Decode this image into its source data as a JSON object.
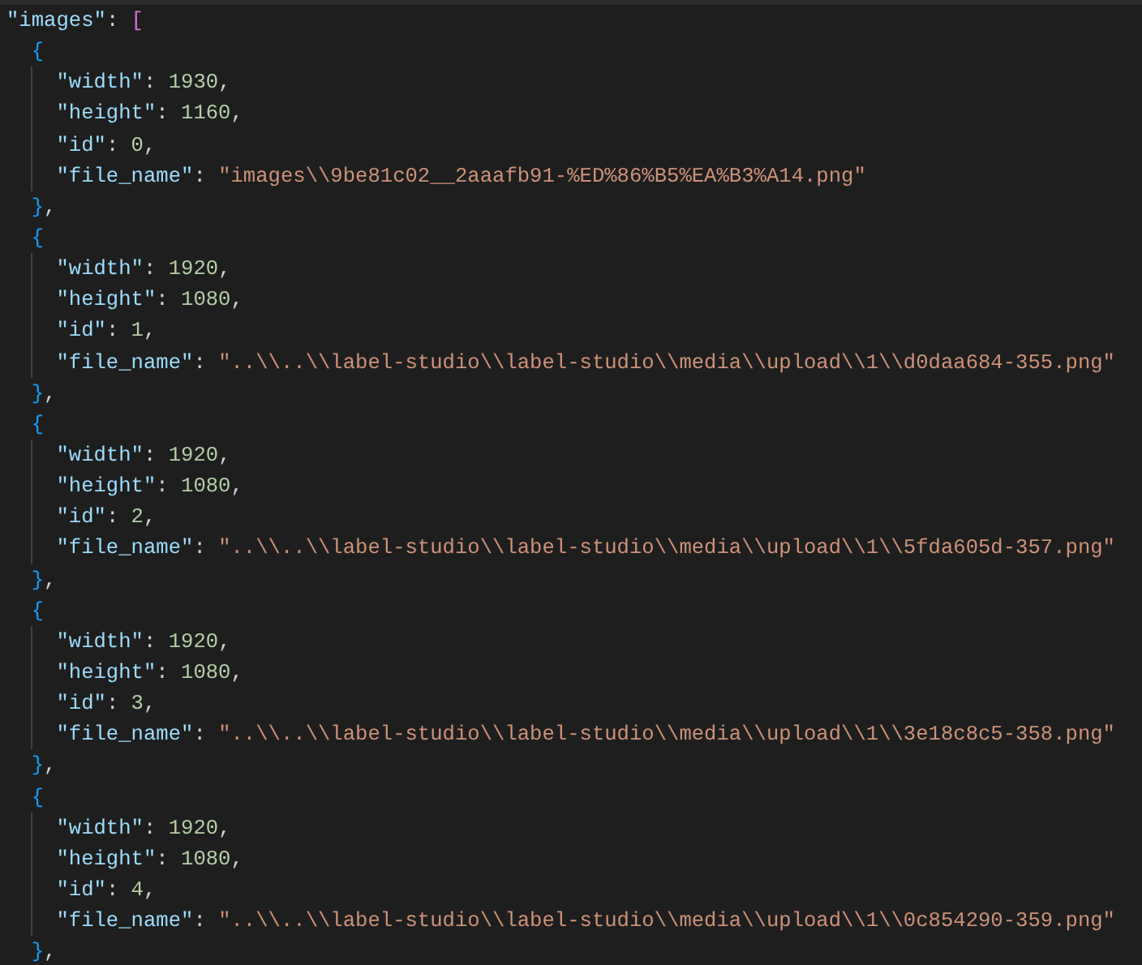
{
  "editor": {
    "lines": [
      "\"images\": [",
      "  {",
      "    \"width\": 1930,",
      "    \"height\": 1160,",
      "    \"id\": 0,",
      "    \"file_name\": \"images\\\\9be81c02__2aaafb91-%ED%86%B5%EA%B3%A14.png\"",
      "  },",
      "  {",
      "    \"width\": 1920,",
      "    \"height\": 1080,",
      "    \"id\": 1,",
      "    \"file_name\": \"..\\\\..\\\\label-studio\\\\label-studio\\\\media\\\\upload\\\\1\\\\d0daa684-355.png\"",
      "  },",
      "  {",
      "    \"width\": 1920,",
      "    \"height\": 1080,",
      "    \"id\": 2,",
      "    \"file_name\": \"..\\\\..\\\\label-studio\\\\label-studio\\\\media\\\\upload\\\\1\\\\5fda605d-357.png\"",
      "  },",
      "  {",
      "    \"width\": 1920,",
      "    \"height\": 1080,",
      "    \"id\": 3,",
      "    \"file_name\": \"..\\\\..\\\\label-studio\\\\label-studio\\\\media\\\\upload\\\\1\\\\3e18c8c5-358.png\"",
      "  },",
      "  {",
      "    \"width\": 1920,",
      "    \"height\": 1080,",
      "    \"id\": 4,",
      "    \"file_name\": \"..\\\\..\\\\label-studio\\\\label-studio\\\\media\\\\upload\\\\1\\\\0c854290-359.png\"",
      "  },"
    ]
  }
}
